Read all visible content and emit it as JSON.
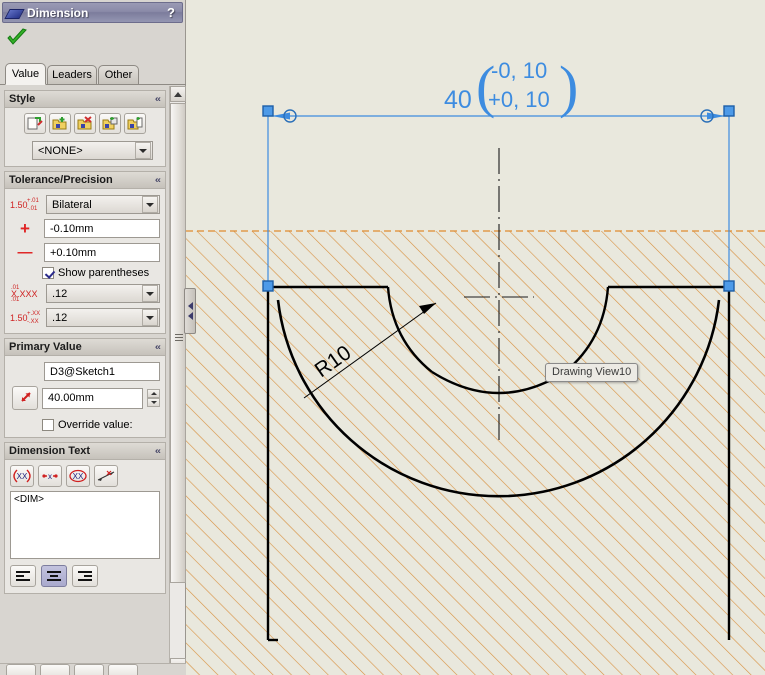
{
  "panel": {
    "title": "Dimension",
    "help_label": "?",
    "accept_icon": "green-check-icon",
    "tabs": [
      {
        "label": "Value",
        "active": true
      },
      {
        "label": "Leaders",
        "active": false
      },
      {
        "label": "Other",
        "active": false
      }
    ],
    "groups": {
      "style": {
        "title": "Style",
        "collapse_glyph": "«",
        "buttons": [
          {
            "name": "apply-default-style-button",
            "icon": "style-apply-icon"
          },
          {
            "name": "add-style-button",
            "icon": "style-add-icon"
          },
          {
            "name": "delete-style-button",
            "icon": "style-delete-icon"
          },
          {
            "name": "save-style-button",
            "icon": "style-save-icon"
          },
          {
            "name": "load-style-button",
            "icon": "style-load-icon"
          }
        ],
        "style_select": "<NONE>"
      },
      "tolerance": {
        "title": "Tolerance/Precision",
        "collapse_glyph": "«",
        "type_select": "Bilateral",
        "type_glyph": {
          "base": "1.50",
          "sup": "+.01",
          "sub": "-.01"
        },
        "plus_symbol": "+",
        "plus_value": "-0.10mm",
        "minus_symbol": "—",
        "minus_value": "+0.10mm",
        "show_parentheses_label": "Show parentheses",
        "show_parentheses_underline": "S",
        "show_parentheses_checked": true,
        "unit_precision": ".12",
        "unit_precision_glyph": {
          "base": "X.XXX",
          "sup": ".01",
          "sub": ".01"
        },
        "tolerance_precision": ".12",
        "tolerance_precision_glyph": {
          "base": "1.50",
          "sup": "+.XX",
          "sub": "-.XX"
        }
      },
      "primary": {
        "title": "Primary Value",
        "collapse_glyph": "«",
        "name_value": "D3@Sketch1",
        "link_button_icon": "link-dimension-icon",
        "dim_value": "40.00mm",
        "override_label": "Override value:",
        "override_underline": "O",
        "override_checked": false
      },
      "dimension_text": {
        "title": "Dimension Text",
        "collapse_glyph": "«",
        "buttons": [
          {
            "name": "add-parentheses-button",
            "icon": "parentheses-icon",
            "label": "(XX)"
          },
          {
            "name": "add-inspection-button",
            "icon": "inspection-icon",
            "label": "•X•"
          },
          {
            "name": "center-dimension-button",
            "icon": "boxed-dim-icon",
            "label": "XX"
          },
          {
            "name": "offset-text-button",
            "icon": "offset-text-icon",
            "label": "X"
          }
        ],
        "text_content": "<DIM>",
        "align_buttons": [
          {
            "name": "align-left-button",
            "icon": "align-left-icon",
            "active": false
          },
          {
            "name": "align-center-button",
            "icon": "align-center-icon",
            "active": true
          },
          {
            "name": "align-right-button",
            "icon": "align-right-icon",
            "active": false
          }
        ]
      }
    },
    "scrollbar": {
      "up_icon": "scroll-up-icon",
      "down_icon": "scroll-down-icon"
    },
    "splitter_icon": "splitter-chevron-icon"
  },
  "canvas": {
    "dimension": {
      "value": "40",
      "tolerance_upper": "-0, 10",
      "tolerance_lower": "+0, 10",
      "paren_open": "(",
      "paren_close": ")",
      "color": "#3d8ce0"
    },
    "radius_label": "R10",
    "tooltip": "Drawing View10",
    "colors": {
      "background": "#e9e8dd",
      "hatch": "#d9913f",
      "section_boundary": "#e08a30",
      "geometry": "#000000",
      "selection_blue": "#3d8ce0",
      "handle_fill": "#4d9ae8"
    }
  }
}
